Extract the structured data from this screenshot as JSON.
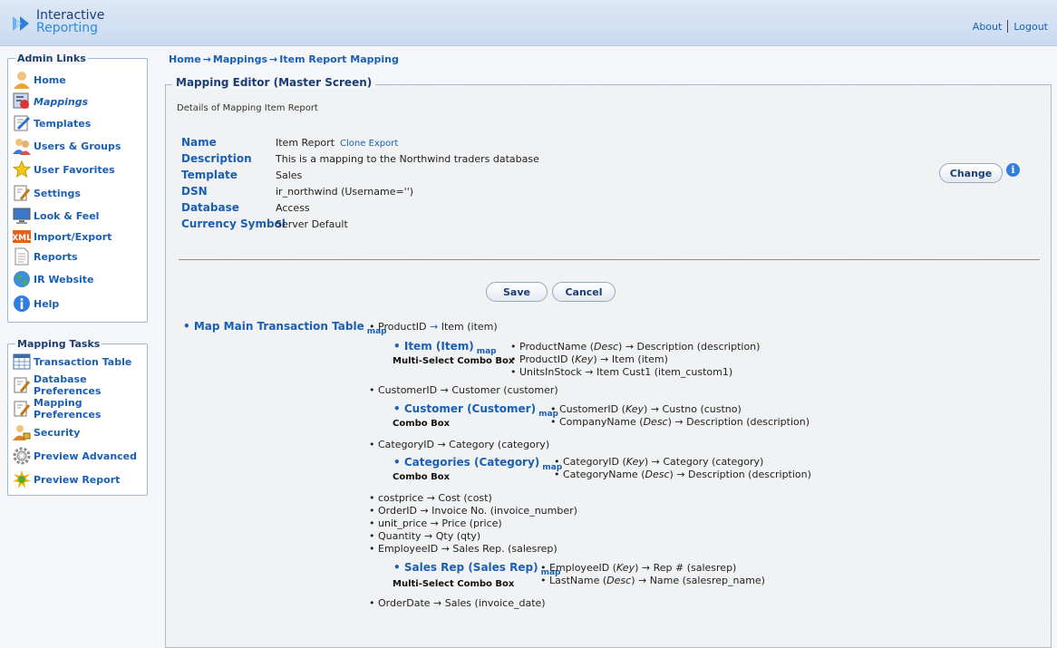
{
  "app": {
    "logo_line1": "Interactive",
    "logo_line2": "Reporting"
  },
  "toplinks": {
    "about": "About",
    "logout": "Logout"
  },
  "admin": {
    "title": "Admin Links",
    "items": [
      {
        "label": "Home",
        "icon": "user-icon"
      },
      {
        "label": "Mappings",
        "icon": "mappings-icon"
      },
      {
        "label": "Templates",
        "icon": "templates-icon"
      },
      {
        "label": "Users & Groups",
        "icon": "users-icon"
      },
      {
        "label": "User Favorites",
        "icon": "star-icon"
      },
      {
        "label": "Settings",
        "icon": "settings-icon"
      },
      {
        "label": "Look & Feel",
        "icon": "monitor-icon"
      },
      {
        "label": "Import/Export",
        "icon": "xml-icon"
      },
      {
        "label": "Reports",
        "icon": "document-icon"
      },
      {
        "label": "IR Website",
        "icon": "globe-icon"
      },
      {
        "label": "Help",
        "icon": "info-icon"
      }
    ]
  },
  "tasks": {
    "title": "Mapping Tasks",
    "items": [
      {
        "label": "Transaction Table"
      },
      {
        "label": "Database Preferences"
      },
      {
        "label": "Mapping Preferences"
      },
      {
        "label": "Security"
      },
      {
        "label": "Preview Advanced"
      },
      {
        "label": "Preview Report"
      }
    ]
  },
  "breadcrumb": {
    "home": "Home",
    "mappings": "Mappings",
    "current": "Item Report Mapping",
    "arrow": "→"
  },
  "editor": {
    "title": "Mapping Editor (Master Screen)",
    "caption": "Details of Mapping Item Report",
    "fields": {
      "name_label": "Name",
      "name_value": "Item Report",
      "clone_export": "Clone Export",
      "desc_label": "Description",
      "desc_value": "This is a mapping to the Northwind traders database",
      "template_label": "Template",
      "template_value": "Sales",
      "dsn_label": "DSN",
      "dsn_value": "ir_northwind (Username='')",
      "db_label": "Database",
      "db_value": "Access",
      "currency_label": "Currency Symbol",
      "currency_value": "Server Default"
    },
    "change_button": "Change",
    "save_button": "Save",
    "cancel_button": "Cancel"
  },
  "tree": {
    "map_word": "map",
    "root": "Map Main Transaction Table",
    "r1": "ProductID",
    "r1_to": "Item (item)",
    "item_head": "Item (Item)",
    "item_type": "Multi-Select Combo Box",
    "item_sub1_a": "ProductName (",
    "item_sub1_k": "Desc",
    "item_sub1_b": ") → Description (description)",
    "item_sub2_a": "ProductID (",
    "item_sub2_k": "Key",
    "item_sub2_b": ") → Item (item)",
    "item_sub3": "UnitsInStock → Item Cust1 (item_custom1)",
    "r2": "CustomerID → Customer (customer)",
    "cust_head": "Customer (Customer)",
    "cust_type": "Combo Box",
    "cust_sub1_a": "CustomerID (",
    "cust_sub1_k": "Key",
    "cust_sub1_b": ") → Custno (custno)",
    "cust_sub2_a": "CompanyName (",
    "cust_sub2_k": "Desc",
    "cust_sub2_b": ") → Description (description)",
    "r3": "CategoryID → Category (category)",
    "cat_head": "Categories (Category)",
    "cat_type": "Combo Box",
    "cat_sub1_a": "CategoryID (",
    "cat_sub1_k": "Key",
    "cat_sub1_b": ") → Category (category)",
    "cat_sub2_a": "CategoryName (",
    "cat_sub2_k": "Desc",
    "cat_sub2_b": ") → Description (description)",
    "r4": "costprice → Cost (cost)",
    "r5": "OrderID → Invoice No. (invoice_number)",
    "r6": "unit_price → Price (price)",
    "r7": "Quantity → Qty (qty)",
    "r8": "EmployeeID → Sales Rep. (salesrep)",
    "rep_head": "Sales Rep (Sales Rep)",
    "rep_type": "Multi-Select Combo Box",
    "rep_sub1_a": "EmployeeID (",
    "rep_sub1_k": "Key",
    "rep_sub1_b": ") → Rep # (salesrep)",
    "rep_sub2_a": "LastName (",
    "rep_sub2_k": "Desc",
    "rep_sub2_b": ") → Name (salesrep_name)",
    "r9": "OrderDate → Sales (invoice_date)"
  }
}
